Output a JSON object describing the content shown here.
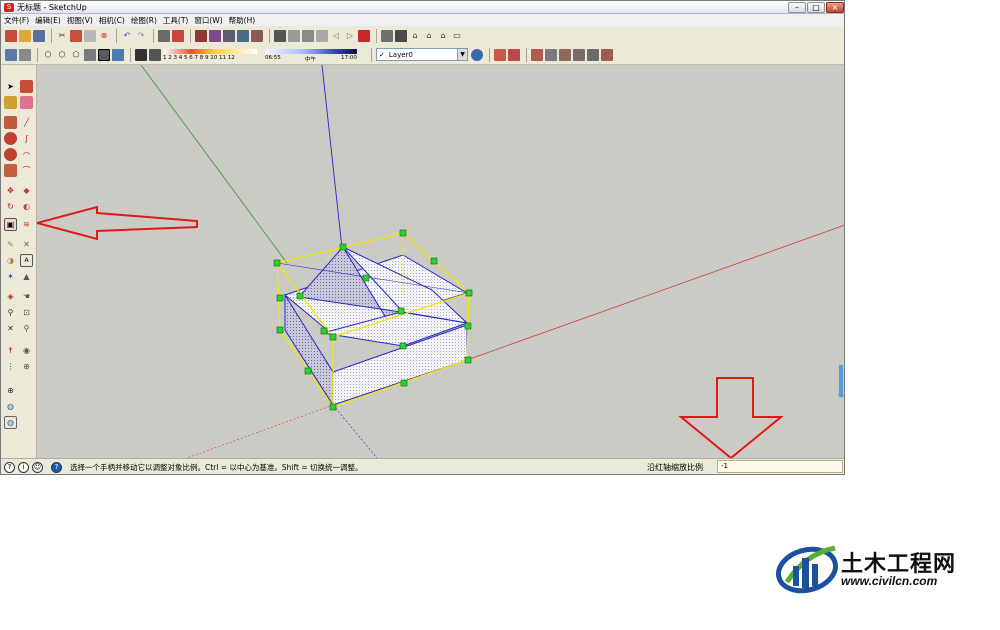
{
  "window": {
    "title": "无标题 - SketchUp",
    "app_icon_glyph": "S",
    "controls": [
      "–",
      "□",
      "×"
    ]
  },
  "menubar": {
    "items": [
      "文件(F)",
      "编辑(E)",
      "视图(V)",
      "相机(C)",
      "绘图(R)",
      "工具(T)",
      "窗口(W)",
      "帮助(H)"
    ]
  },
  "toolbar": {
    "shadow_months": "1 2 3 4 5 6 7 8 9 10 11 12",
    "shadow_time_start": "06:55",
    "shadow_time_mid": "中午",
    "shadow_time_end": "17:00",
    "layer_check": "✓",
    "layer_name": "Layer0",
    "layer_drop": "▼"
  },
  "status": {
    "hint": "选择一个手柄并移动它以调整对象比例。Ctrl = 以中心为基准。Shift = 切换统一调整。",
    "help_icon": "?",
    "vcb_label": "沿红轴缩放比例",
    "vcb_value": "-1"
  },
  "watermark": {
    "name": "土木工程网",
    "url": "www.civilcn.com"
  },
  "colors": {
    "red_axis": "#d23c3c",
    "green_axis": "#2f9a2f",
    "blue_axis": "#2626c8",
    "selection": "#f0e800",
    "grip": "#2fd02f",
    "arrow": "#e01818"
  }
}
